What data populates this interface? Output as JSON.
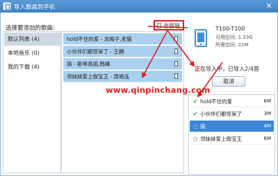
{
  "window": {
    "title": "导入歌曲到手机",
    "close_glyph": "✕"
  },
  "select_label": "选择要添加的歌曲:",
  "import_all_label": "全部导入",
  "playlists": [
    {
      "label": "默认列表 (4)",
      "active": true
    },
    {
      "label": "本地音乐 (0)",
      "active": false
    },
    {
      "label": "我的下载 (4)",
      "active": false
    }
  ],
  "songs": [
    {
      "title": "hold不住的爱 - 龙梅子,老猫"
    },
    {
      "title": "小伙伴们都惊呆了 - 王麟"
    },
    {
      "title": "猜 - 斯琴高丽,韩峰"
    },
    {
      "title": "邻妹妹爱上假宝王 - 周艳泓"
    }
  ],
  "watermark": "www.qinpinchang.com",
  "device": {
    "name": "T100-T100",
    "available": "可用空间: 1.33G",
    "used": "所需空间: 22M"
  },
  "progress": {
    "prefix": "正",
    "text": "在导入中，已导入2/4首",
    "done": 2,
    "total": 4
  },
  "cancel_label": "取消",
  "queue": [
    {
      "title": "hold不住的爱",
      "size": "6M",
      "status": "done",
      "status_glyph": "✔"
    },
    {
      "title": "小伙伴们都惊呆了",
      "size": "3M",
      "status": "done",
      "status_glyph": "✔"
    },
    {
      "title": "猜",
      "size": "4M",
      "status": "importing",
      "status_glyph": "◌"
    },
    {
      "title": "邻妹妹爱上假宝王",
      "size": "6M",
      "status": "waiting",
      "status_glyph": "◷"
    }
  ],
  "colors": {
    "titlebar": "#3b7fc4",
    "selected_song_row": "#a9d0ee",
    "active_queue_row": "#3b86d6",
    "annotation_red": "#d42020",
    "watermark": "#e51c1c"
  }
}
